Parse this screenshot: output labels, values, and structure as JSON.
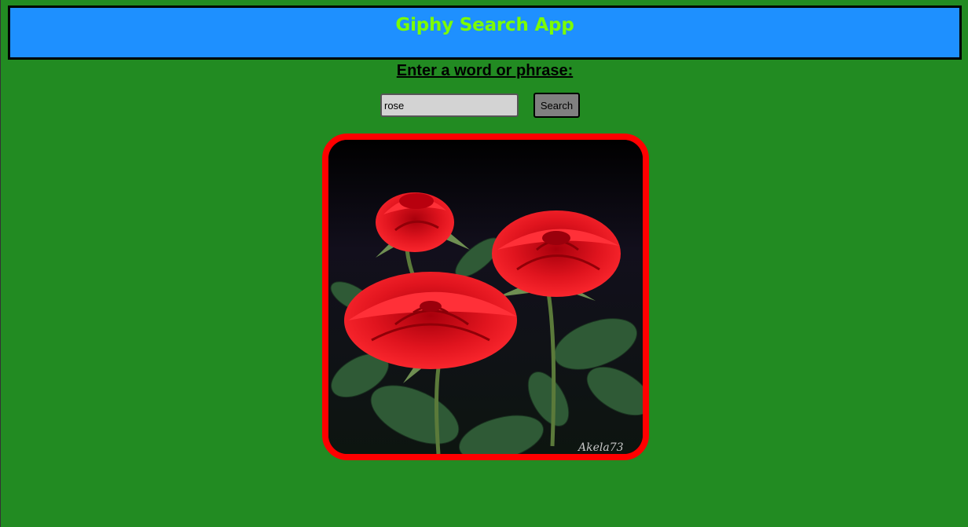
{
  "header": {
    "title": "Giphy Search App"
  },
  "search": {
    "prompt": "Enter a word or phrase:",
    "value": "rose",
    "button_label": "Search"
  },
  "result": {
    "watermark": "Akela73",
    "colors": {
      "frame": "#ff0000",
      "rose": "#d0101a",
      "leaf": "#2f5a36"
    }
  },
  "colors": {
    "page_background": "#228b22",
    "header_background": "#1e90ff",
    "header_text": "#7cfc00"
  }
}
